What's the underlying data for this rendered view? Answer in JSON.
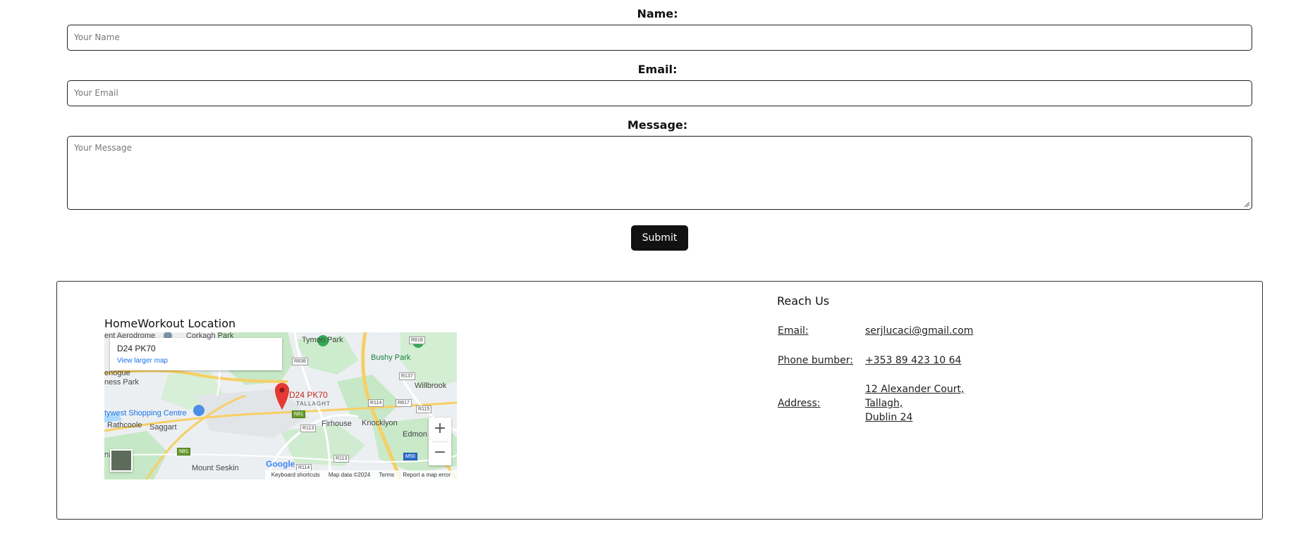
{
  "form": {
    "name_label": "Name:",
    "name_placeholder": "Your Name",
    "email_label": "Email:",
    "email_placeholder": "Your Email",
    "message_label": "Message:",
    "message_placeholder": "Your Message",
    "submit_label": "Submit"
  },
  "location": {
    "title": "HomeWorkout Location",
    "map": {
      "place_name": "D24 PK70",
      "view_larger": "View larger map",
      "pin_label": "D24 PK70",
      "pin_sublabel": "TALLAGHT",
      "zoom_in": "+",
      "zoom_out": "−",
      "logo": "Google",
      "attribution": {
        "shortcuts": "Keyboard shortcuts",
        "data": "Map data ©2024",
        "terms": "Terms",
        "report": "Report a map error"
      },
      "places": {
        "aerodrome": "ent Aerodrome",
        "corkagh": "Corkagh Park",
        "tymon": "Tymon Park",
        "bushy": "Bushy Park",
        "willbrook": "Willbrook",
        "enogue": "enogue",
        "ness_park": "ness Park",
        "citywest": "tywest Shopping Centre",
        "rathcoole": "Rathcoole",
        "saggart": "Saggart",
        "firhouse": "Firhouse",
        "knocklyon": "Knocklyon",
        "edmonton": "Edmon",
        "mount_seskin": "Mount Seskin",
        "na": "na"
      },
      "roads": {
        "r838": "R838",
        "r818": "R818",
        "r137": "R137",
        "r114a": "R114",
        "r817": "R817",
        "r115": "R115",
        "n81a": "N81",
        "r113a": "R113",
        "n81b": "N81",
        "r113b": "R113",
        "m50": "M50",
        "r114b": "R114"
      }
    }
  },
  "contact": {
    "title": "Reach Us",
    "email_label": "Email:",
    "email_value": "serjlucaci@gmail.com",
    "phone_label": "Phone bumber:",
    "phone_value": "+353 89 423 10 64",
    "address_label": "Address:",
    "address_line1": "12 Alexander Court,",
    "address_line2": "Tallagh,",
    "address_line3": "Dublin 24"
  },
  "colors": {
    "button_bg": "#111111",
    "link_blue": "#1a73e8",
    "pin_red": "#e53935",
    "park_green": "#c6e8c6"
  }
}
